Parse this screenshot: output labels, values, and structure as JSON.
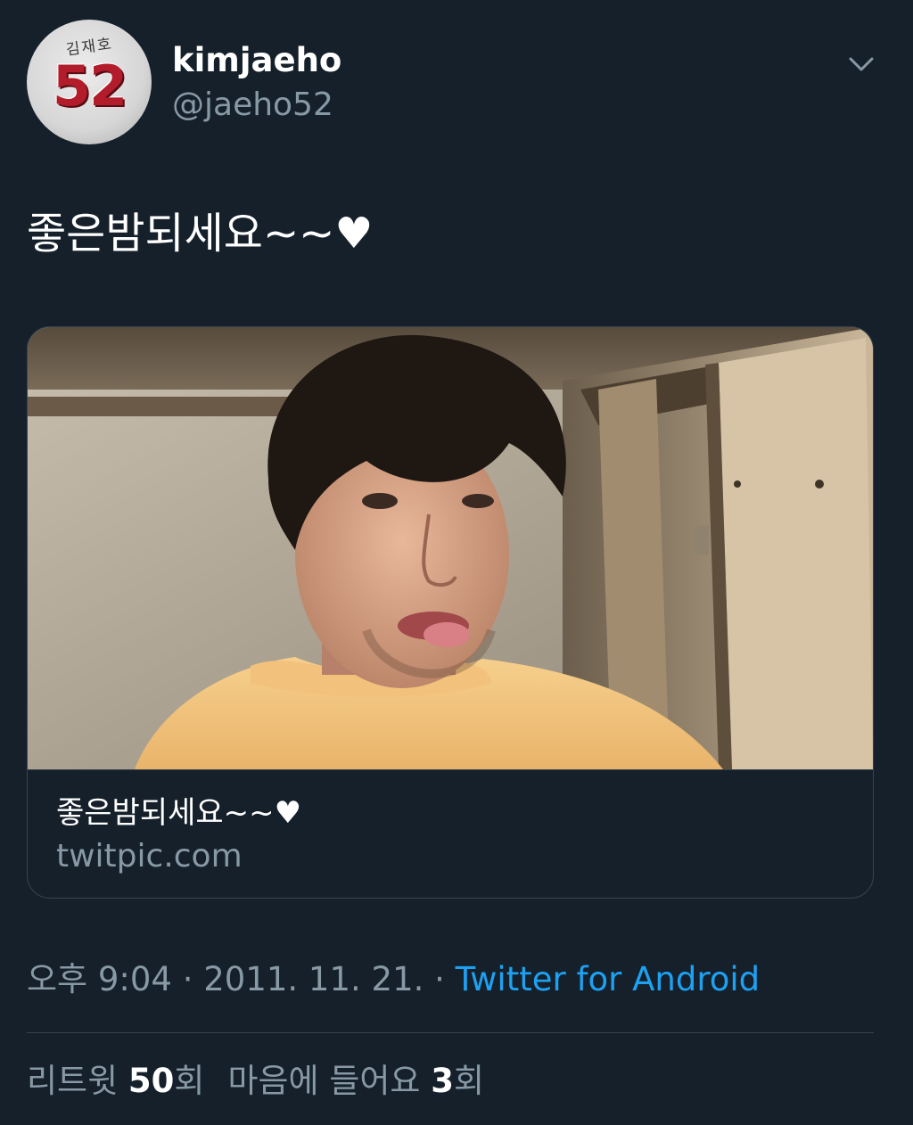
{
  "user": {
    "display_name": "kimjaeho",
    "handle": "@jaeho52",
    "avatar_jersey_name": "김재호",
    "avatar_jersey_number": "52"
  },
  "tweet": {
    "text": "좋은밤되세요~~♥"
  },
  "card": {
    "title": "좋은밤되세요~~♥",
    "domain": "twitpic.com"
  },
  "meta": {
    "time": "오후 9:04",
    "separator": " · ",
    "date": "2011. 11. 21.",
    "source": "Twitter for Android"
  },
  "stats": {
    "retweets_label": "리트윗",
    "retweets_count": "50",
    "retweets_suffix": "회",
    "likes_label": "마음에 들어요",
    "likes_count": "3",
    "likes_suffix": "회"
  },
  "colors": {
    "background": "#15202b",
    "secondary_text": "#8899a6",
    "link": "#1da1f2",
    "border": "#38444d"
  }
}
